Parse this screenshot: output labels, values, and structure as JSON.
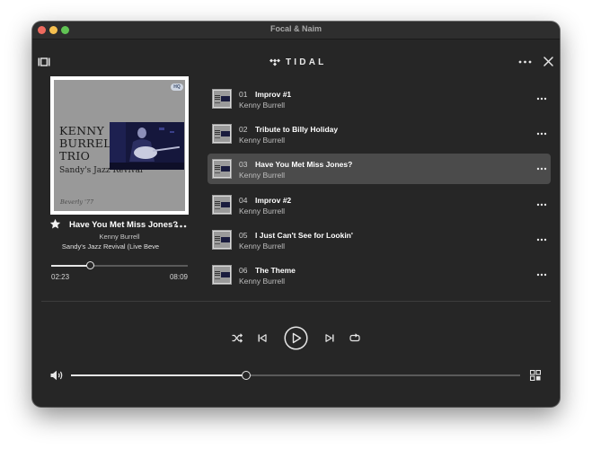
{
  "window": {
    "title": "Focal & Naim"
  },
  "header": {
    "logo_text": "TIDAL",
    "left_icon": "queue-view-icon",
    "more_icon": "more-horizontal-icon",
    "close_icon": "close-icon"
  },
  "cover": {
    "artist_lines": "KENNY\nBURRELL\nTRIO",
    "album_line": "Sandy's Jazz Revival",
    "signature": "Beverly '77",
    "badge": "HQ"
  },
  "now_playing": {
    "title": "Have You Met Miss Jones?",
    "artist": "Kenny Burrell",
    "album": "Sandy's Jazz Revival (Live Beve",
    "elapsed": "02:23",
    "total": "08:09",
    "progress_fraction": 0.29,
    "favorite_icon": "star-icon"
  },
  "tracks": [
    {
      "number": "01",
      "title": "Improv #1",
      "artist": "Kenny Burrell",
      "active": false
    },
    {
      "number": "02",
      "title": "Tribute to Billy Holiday",
      "artist": "Kenny Burrell",
      "active": false
    },
    {
      "number": "03",
      "title": "Have You Met Miss Jones?",
      "artist": "Kenny Burrell",
      "active": true
    },
    {
      "number": "04",
      "title": "Improv #2",
      "artist": "Kenny Burrell",
      "active": false
    },
    {
      "number": "05",
      "title": "I Just Can't See for Lookin'",
      "artist": "Kenny Burrell",
      "active": false
    },
    {
      "number": "06",
      "title": "The Theme",
      "artist": "Kenny Burrell",
      "active": false
    }
  ],
  "controls": {
    "shuffle_icon": "shuffle-icon",
    "previous_icon": "skip-previous-icon",
    "play_icon": "play-icon",
    "next_icon": "skip-next-icon",
    "repeat_icon": "repeat-icon"
  },
  "volume": {
    "level_fraction": 0.39,
    "icon": "speaker-icon",
    "grid_icon": "grid-view-icon"
  },
  "colors": {
    "background": "#262626",
    "active_row": "#4b4b4b",
    "text": "#ffffff"
  }
}
